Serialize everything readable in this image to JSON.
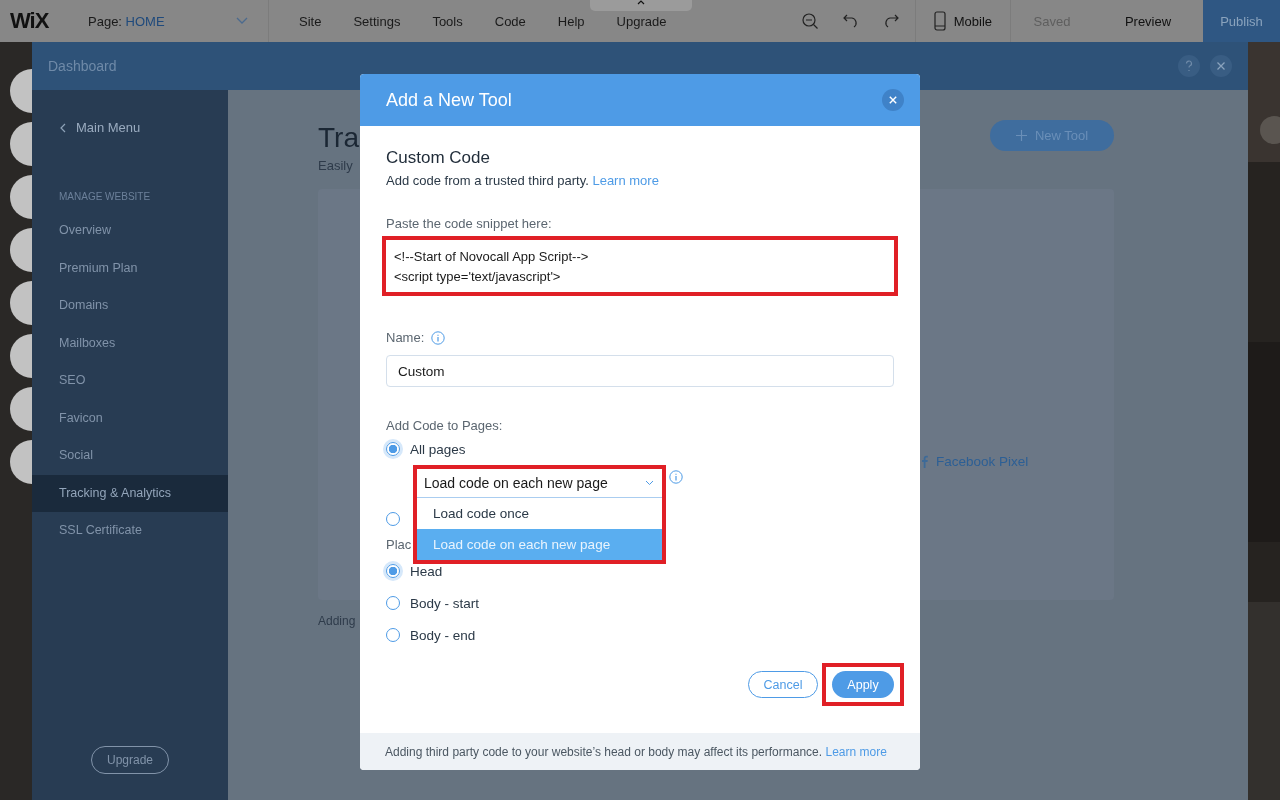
{
  "top_bar": {
    "logo": "WiX",
    "page_label": "Page:",
    "page_name": "HOME",
    "menu": [
      "Site",
      "Settings",
      "Tools",
      "Code",
      "Help",
      "Upgrade"
    ],
    "mobile_label": "Mobile",
    "saved": "Saved",
    "preview": "Preview",
    "publish": "Publish"
  },
  "dashboard": {
    "title": "Dashboard",
    "back_label": "Main Menu",
    "section": "MANAGE WEBSITE",
    "items": [
      {
        "label": "Overview",
        "selected": false
      },
      {
        "label": "Premium Plan",
        "selected": false
      },
      {
        "label": "Domains",
        "selected": false
      },
      {
        "label": "Mailboxes",
        "selected": false
      },
      {
        "label": "SEO",
        "selected": false
      },
      {
        "label": "Favicon",
        "selected": false
      },
      {
        "label": "Social",
        "selected": false
      },
      {
        "label": "Tracking & Analytics",
        "selected": true
      },
      {
        "label": "SSL Certificate",
        "selected": false
      }
    ],
    "upgrade": "Upgrade",
    "page_title": "Tra",
    "page_subtitle": "Easily",
    "new_tool": "New Tool",
    "tool_link": "Facebook Pixel",
    "footer_text": "Adding"
  },
  "dialog": {
    "title": "Add a New Tool",
    "heading": "Custom Code",
    "description": "Add code from a trusted third party.",
    "description_link": "Learn more",
    "code_label": "Paste the code snippet here:",
    "code_lines": [
      "<!--Start of Novocall App Script-->",
      "<script type='text/javascript'>"
    ],
    "code_highlighted": true,
    "name_label": "Name:",
    "name_value": "Custom",
    "pages_label": "Add Code to Pages:",
    "page_options": [
      {
        "label": "All pages",
        "selected": true
      },
      {
        "selected": false
      }
    ],
    "load_select": {
      "value": "Load code on each new page",
      "expanded": true,
      "highlighted": true,
      "options": [
        {
          "label": "Load code once",
          "selected": false
        },
        {
          "label": "Load code on each new page",
          "selected": true
        }
      ]
    },
    "place_label": "Plac",
    "place_options": [
      {
        "label": "Head",
        "selected": true
      },
      {
        "label": "Body - start",
        "selected": false
      },
      {
        "label": "Body - end",
        "selected": false
      }
    ],
    "cancel": "Cancel",
    "apply": {
      "label": "Apply",
      "highlighted": true
    },
    "footer_note": "Adding third party code to your website’s head or body may affect its performance.",
    "footer_link": "Learn more"
  }
}
